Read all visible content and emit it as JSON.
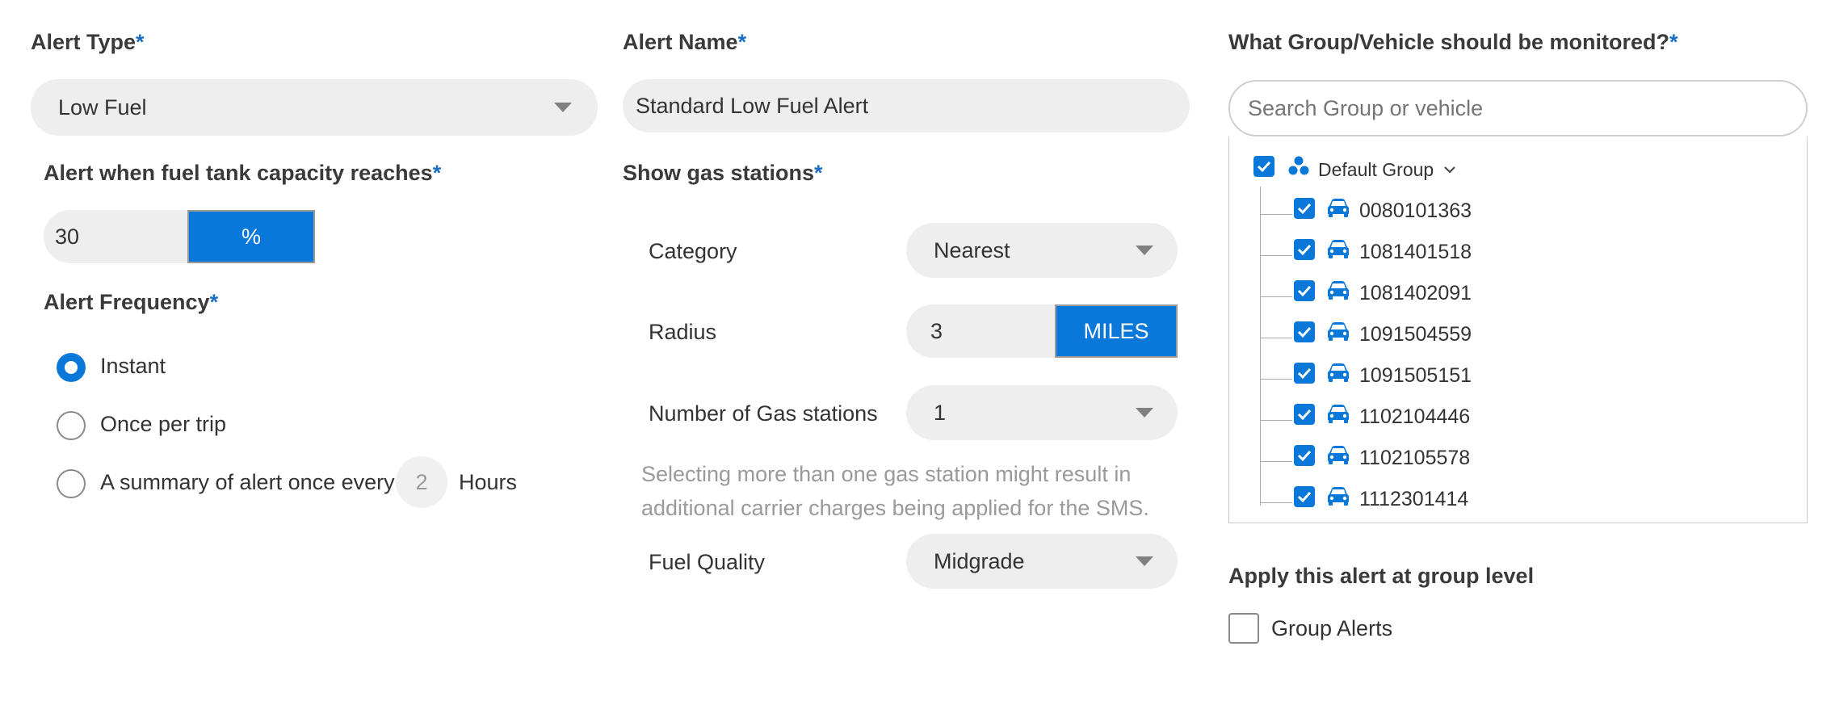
{
  "alert_type": {
    "label": "Alert Type",
    "required": "*",
    "value": "Low Fuel"
  },
  "alert_name": {
    "label": "Alert Name",
    "required": "*",
    "value": "Standard Low Fuel Alert"
  },
  "monitor": {
    "label": "What Group/Vehicle should be monitored?",
    "required": "*",
    "search_placeholder": "Search Group or vehicle",
    "group_name": "Default Group",
    "vehicles": [
      "0080101363",
      "1081401518",
      "1081402091",
      "1091504559",
      "1091505151",
      "1102104446",
      "1102105578",
      "1112301414"
    ]
  },
  "capacity": {
    "label": "Alert when fuel tank capacity reaches",
    "required": "*",
    "value": "30",
    "unit": "%"
  },
  "frequency": {
    "label": "Alert Frequency",
    "required": "*",
    "options": [
      "Instant",
      "Once per trip",
      "A summary of alert once every"
    ],
    "selected": "Instant",
    "hours_value": "2",
    "hours_label": "Hours"
  },
  "gas": {
    "label": "Show gas stations",
    "required": "*",
    "category_label": "Category",
    "category_value": "Nearest",
    "radius_label": "Radius",
    "radius_value": "3",
    "radius_unit": "MILES",
    "count_label": "Number of Gas stations",
    "count_value": "1",
    "note_line1": "Selecting more than one gas station might result in",
    "note_line2": "additional carrier charges being applied for the SMS.",
    "quality_label": "Fuel Quality",
    "quality_value": "Midgrade"
  },
  "group_level": {
    "label": "Apply this alert at group level",
    "checkbox_label": "Group Alerts"
  },
  "colors": {
    "accent": "#0a78d8",
    "required": "#1a6fc4",
    "field_bg": "#eeeeee"
  }
}
